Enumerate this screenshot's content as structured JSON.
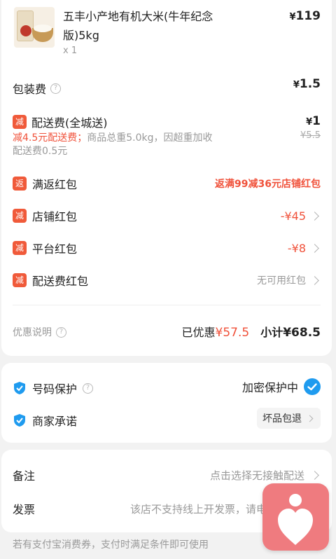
{
  "product": {
    "name_line1": "五丰小产地有机大米(牛年纪念",
    "name_line2": "版)5kg",
    "qty": "x 1",
    "currency": "¥",
    "price": "119",
    "image_label": "rice-bag-thumbnail"
  },
  "packaging": {
    "label": "包装费",
    "currency": "¥",
    "price": "1.5"
  },
  "delivery": {
    "badge": "减",
    "label": "配送费(全城送)",
    "currency": "¥",
    "price": "1",
    "original": "¥5.5",
    "note_red": "减4.5元配送费；",
    "note_gray_1": "商品总重5.0kg，因超重加收",
    "note_gray_2": "配送费0.5元"
  },
  "promos": [
    {
      "badge": "返",
      "label": "满返红包",
      "value": "返满99减36元店铺红包"
    },
    {
      "badge": "减",
      "label": "店铺红包",
      "value": "-¥45"
    },
    {
      "badge": "减",
      "label": "平台红包",
      "value": "-¥8"
    },
    {
      "badge": "减",
      "label": "配送费红包",
      "value": "无可用红包"
    }
  ],
  "summary": {
    "discount_help": "优惠说明",
    "saved_label": "已优惠",
    "saved_value": "¥57.5",
    "subtotal_label": "小计",
    "subtotal_value": "¥68.5"
  },
  "protection": {
    "phone_label": "号码保护",
    "phone_status": "加密保护中",
    "merchant_label": "商家承诺",
    "merchant_tag": "坏品包退"
  },
  "extras": {
    "remark_label": "备注",
    "remark_value": "点击选择无接触配送",
    "invoice_label": "发票",
    "invoice_value": "该店不支持线上开发票，请电"
  },
  "footer_tip": "若有支付宝消费券，支付时满足条件即可使用",
  "colors": {
    "accent_red": "#f0513a",
    "badge_red": "#f05a3a",
    "check_blue": "#1f9bef",
    "float_pink": "#ef7b7f"
  }
}
